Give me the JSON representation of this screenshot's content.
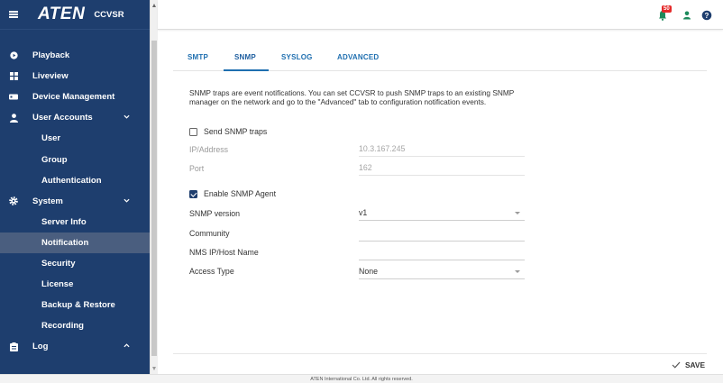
{
  "brand": {
    "logo": "ATEN",
    "product": "CCVSR"
  },
  "sidebar": {
    "items": [
      {
        "label": "Playback",
        "icon": "play-circle-icon"
      },
      {
        "label": "Liveview",
        "icon": "grid-icon"
      },
      {
        "label": "Device Management",
        "icon": "device-icon"
      },
      {
        "label": "User Accounts",
        "icon": "user-icon",
        "expanded": true
      },
      {
        "label": "User",
        "sub": true
      },
      {
        "label": "Group",
        "sub": true
      },
      {
        "label": "Authentication",
        "sub": true
      },
      {
        "label": "System",
        "icon": "gear-icon",
        "expanded": true
      },
      {
        "label": "Server Info",
        "sub": true
      },
      {
        "label": "Notification",
        "sub": true,
        "active": true
      },
      {
        "label": "Security",
        "sub": true
      },
      {
        "label": "License",
        "sub": true
      },
      {
        "label": "Backup & Restore",
        "sub": true
      },
      {
        "label": "Recording",
        "sub": true
      },
      {
        "label": "Log",
        "icon": "clipboard-icon",
        "expanded": false
      }
    ]
  },
  "topbar": {
    "notification_count": "50"
  },
  "tabs": [
    "SMTP",
    "SNMP",
    "SYSLOG",
    "ADVANCED"
  ],
  "active_tab": "SNMP",
  "description": "SNMP traps are event notifications. You can set CCVSR to push SNMP traps to an existing SNMP manager on the network and go to the \"Advanced\" tab to configuration notification events.",
  "form": {
    "send_traps_label": "Send SNMP traps",
    "send_traps_checked": false,
    "ip_label": "IP/Address",
    "ip_value": "10.3.167.245",
    "port_label": "Port",
    "port_value": "162",
    "enable_agent_label": "Enable SNMP Agent",
    "enable_agent_checked": true,
    "version_label": "SNMP version",
    "version_value": "v1",
    "community_label": "Community",
    "community_value": "",
    "nms_label": "NMS IP/Host Name",
    "nms_value": "",
    "access_label": "Access Type",
    "access_value": "None"
  },
  "actions": {
    "save_label": "SAVE"
  },
  "footer": {
    "copyright": "ATEN International Co. Ltd. All rights reserved."
  },
  "colors": {
    "sidebar_bg": "#1e3e6e",
    "accent": "#1f6fb0",
    "active_item": "#4a5e7f",
    "badge": "#e52a2a"
  }
}
